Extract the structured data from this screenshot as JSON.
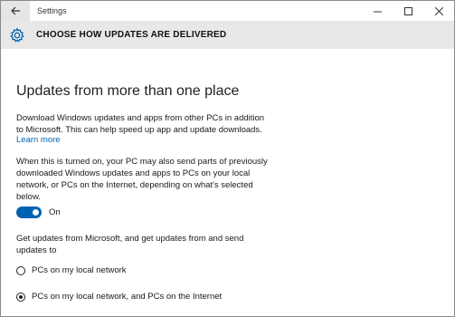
{
  "window": {
    "title": "Settings"
  },
  "header": {
    "title": "CHOOSE HOW UPDATES ARE DELIVERED"
  },
  "main": {
    "heading": "Updates from more than one place",
    "intro": "Download Windows updates and apps from other PCs in addition to Microsoft. This can help speed up app and update downloads.",
    "learn_more": "Learn more",
    "explanation": "When this is turned on, your PC may also send parts of previously downloaded Windows updates and apps to PCs on your local network, or PCs on the Internet, depending on what's selected below.",
    "toggle": {
      "state": "On",
      "is_on": true
    },
    "choice_prompt": "Get updates from Microsoft, and get updates from and send updates to",
    "options": [
      {
        "label": "PCs on my local network",
        "selected": false
      },
      {
        "label": "PCs on my local network, and PCs on the Internet",
        "selected": true
      }
    ]
  },
  "colors": {
    "accent": "#0063b1",
    "header_bg": "#e8e8e8"
  },
  "icons": {
    "back": "back-arrow-icon",
    "settings": "gear-icon"
  }
}
